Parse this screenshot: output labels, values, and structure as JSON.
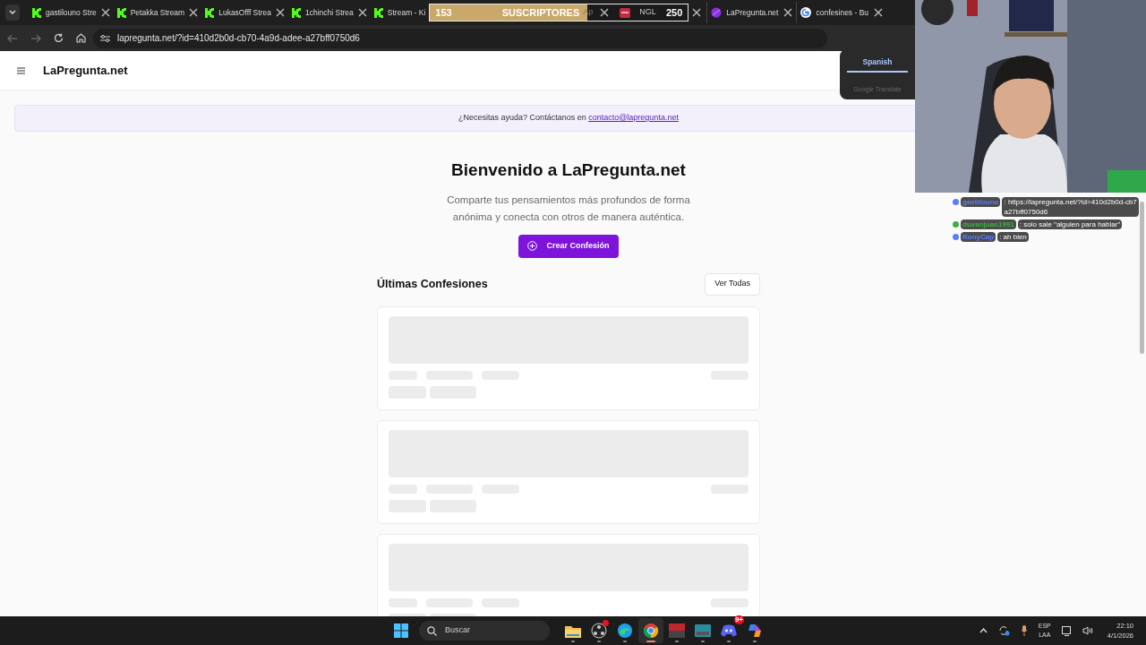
{
  "browser": {
    "tabs": [
      {
        "title": "gastilouno Stre",
        "kind": "kick"
      },
      {
        "title": "Petakka Stream",
        "kind": "kick"
      },
      {
        "title": "LukasOfff Strea",
        "kind": "kick"
      },
      {
        "title": "1chinchi Strea",
        "kind": "kick"
      },
      {
        "title": "Stream - Ki",
        "kind": "kick"
      }
    ],
    "hidden_tab": {
      "title": "Ap"
    },
    "ngl_tab": {
      "title": "NGL"
    },
    "more_tabs": [
      {
        "title": "LaPregunta.net",
        "kind": "dot"
      },
      {
        "title": "confesines - Bu",
        "kind": "google"
      }
    ],
    "address": "lapregunta.net/?id=410d2b0d-cb70-4a9d-adee-a27bff0750d6"
  },
  "sub_goal": {
    "current": "153",
    "label": "SUSCRIPTORES",
    "goal": "250",
    "level": 0.61
  },
  "translate_popup": {
    "tabs": [
      {
        "label": "Spanish",
        "selected": true
      }
    ],
    "footer": "Google Translate"
  },
  "site": {
    "logo": "LaPregunta.net",
    "help": {
      "text": "¿Necesitas ayuda? Contáctanos en",
      "link": "contacto@lapregunta.net"
    },
    "title": "Bienvenido a LaPregunta.net",
    "subtitle": "Comparte tus pensamientos más profundos de forma anónima y conecta con otros de manera auténtica.",
    "create_button": "Crear Confesión",
    "section_title": "Últimas Confesiones",
    "view_all": "Ver Todas",
    "cards": [
      {
        "kind": "loading"
      },
      {
        "kind": "loading"
      },
      {
        "kind": "loading"
      }
    ]
  },
  "chat": [
    {
      "user": "gastilouno",
      "color": "#5b7cff",
      "text": ": https://lapregunta.net/?id=410d2b0d-cb7 a27bff0750d6"
    },
    {
      "user": "duvanjuan1991",
      "color": "#3cb043",
      "text": ": solo sale \"alguien para hablar\""
    },
    {
      "user": "RonyCap",
      "color": "#5b7cff",
      "text": ": ah bien"
    }
  ],
  "taskbar": {
    "search": "Buscar",
    "apps": [
      {
        "kind": "folder"
      },
      {
        "kind": "obs",
        "notification": true
      },
      {
        "kind": "edge"
      },
      {
        "kind": "chrome",
        "active": true
      },
      {
        "kind": "voice"
      },
      {
        "kind": "keyboard"
      },
      {
        "kind": "discord",
        "badge": "9+"
      },
      {
        "kind": "copilot"
      }
    ],
    "lang": [
      "ESP",
      "LAA"
    ],
    "time": "22:10",
    "date": "4/1/2026"
  }
}
